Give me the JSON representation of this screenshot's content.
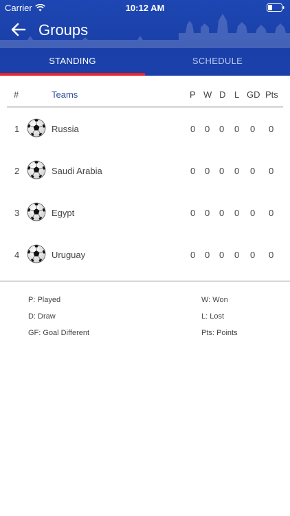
{
  "status_bar": {
    "carrier": "Carrier",
    "time": "10:12 AM"
  },
  "nav": {
    "title": "Groups"
  },
  "tabs": [
    {
      "label": "STANDING",
      "active": true
    },
    {
      "label": "SCHEDULE",
      "active": false
    }
  ],
  "table": {
    "headers": {
      "rank": "#",
      "teams": "Teams",
      "p": "P",
      "w": "W",
      "d": "D",
      "l": "L",
      "gd": "GD",
      "pts": "Pts"
    },
    "rows": [
      {
        "rank": "1",
        "team": "Russia",
        "p": "0",
        "w": "0",
        "d": "0",
        "l": "0",
        "gd": "0",
        "pts": "0"
      },
      {
        "rank": "2",
        "team": "Saudi Arabia",
        "p": "0",
        "w": "0",
        "d": "0",
        "l": "0",
        "gd": "0",
        "pts": "0"
      },
      {
        "rank": "3",
        "team": "Egypt",
        "p": "0",
        "w": "0",
        "d": "0",
        "l": "0",
        "gd": "0",
        "pts": "0"
      },
      {
        "rank": "4",
        "team": "Uruguay",
        "p": "0",
        "w": "0",
        "d": "0",
        "l": "0",
        "gd": "0",
        "pts": "0"
      }
    ]
  },
  "legend": {
    "played": "P: Played",
    "won": "W: Won",
    "draw": "D: Draw",
    "lost": "L: Lost",
    "goal_diff": "GF: Goal Different",
    "points": "Pts: Points"
  },
  "colors": {
    "header_blue": "#1e47b3",
    "tab_indicator": "#e8232a",
    "teams_header": "#2a4aa0"
  },
  "icons": {
    "back": "arrow-left-icon",
    "wifi": "wifi-icon",
    "battery": "battery-icon",
    "team": "soccer-ball-icon"
  }
}
